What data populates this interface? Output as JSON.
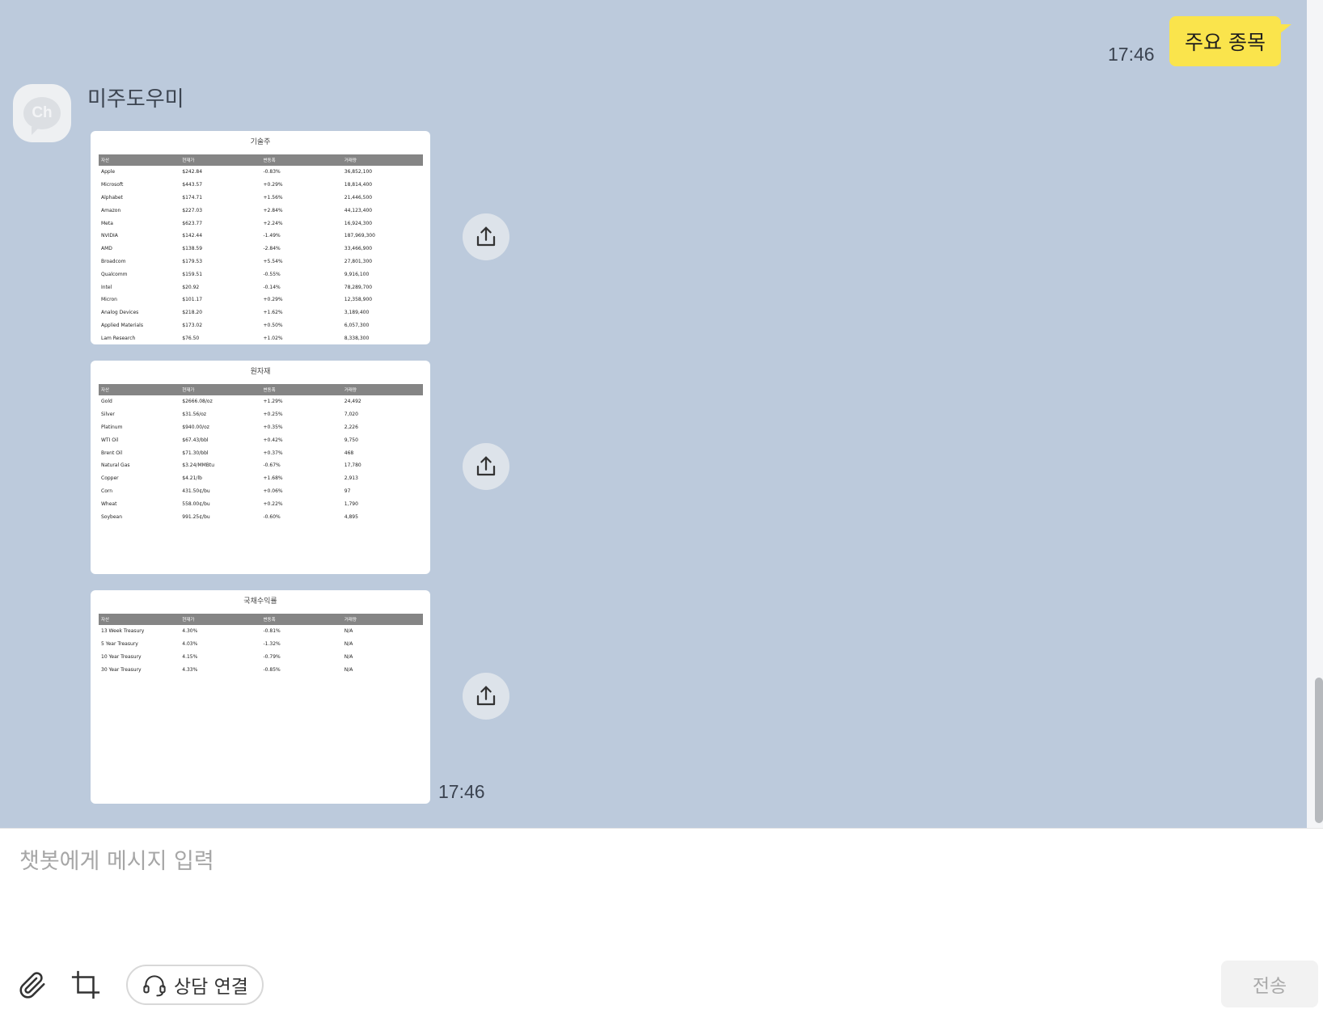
{
  "user_message": {
    "text": "주요 종목",
    "time": "17:46"
  },
  "bot": {
    "name": "미주도우미",
    "avatar_text": "Ch",
    "time": "17:46",
    "cards": [
      {
        "title": "기술주",
        "headers": [
          "자산",
          "현재가",
          "변동폭",
          "거래량"
        ],
        "rows": [
          [
            "Apple",
            "$242.84",
            "-0.83%",
            "36,852,100"
          ],
          [
            "Microsoft",
            "$443.57",
            "+0.29%",
            "18,814,400"
          ],
          [
            "Alphabet",
            "$174.71",
            "+1.56%",
            "21,446,500"
          ],
          [
            "Amazon",
            "$227.03",
            "+2.84%",
            "44,123,400"
          ],
          [
            "Meta",
            "$623.77",
            "+2.24%",
            "16,924,300"
          ],
          [
            "NVIDIA",
            "$142.44",
            "-1.49%",
            "187,969,300"
          ],
          [
            "AMD",
            "$138.59",
            "-2.84%",
            "33,466,900"
          ],
          [
            "Broadcom",
            "$179.53",
            "+5.54%",
            "27,801,300"
          ],
          [
            "Qualcomm",
            "$159.51",
            "-0.55%",
            "9,916,100"
          ],
          [
            "Intel",
            "$20.92",
            "-0.14%",
            "78,289,700"
          ],
          [
            "Micron",
            "$101.17",
            "+0.29%",
            "12,358,900"
          ],
          [
            "Analog Devices",
            "$218.20",
            "+1.62%",
            "3,189,400"
          ],
          [
            "Applied Materials",
            "$173.02",
            "+0.50%",
            "6,057,300"
          ],
          [
            "Lam Research",
            "$76.50",
            "+1.02%",
            "8,338,300"
          ]
        ]
      },
      {
        "title": "원자재",
        "headers": [
          "자산",
          "현재가",
          "변동폭",
          "거래량"
        ],
        "rows": [
          [
            "Gold",
            "$2666.08/oz",
            "+1.29%",
            "24,492"
          ],
          [
            "Silver",
            "$31.56/oz",
            "+0.25%",
            "7,020"
          ],
          [
            "Platinum",
            "$940.00/oz",
            "+0.35%",
            "2,226"
          ],
          [
            "WTI Oil",
            "$67.43/bbl",
            "+0.42%",
            "9,750"
          ],
          [
            "Brent Oil",
            "$71.30/bbl",
            "+0.37%",
            "468"
          ],
          [
            "Natural Gas",
            "$3.24/MMBtu",
            "-0.67%",
            "17,780"
          ],
          [
            "Copper",
            "$4.21/lb",
            "+1.68%",
            "2,913"
          ],
          [
            "Corn",
            "431.50¢/bu",
            "+0.06%",
            "97"
          ],
          [
            "Wheat",
            "558.00¢/bu",
            "+0.22%",
            "1,790"
          ],
          [
            "Soybean",
            "991.25¢/bu",
            "-0.60%",
            "4,895"
          ]
        ]
      },
      {
        "title": "국채수익률",
        "headers": [
          "자산",
          "현재가",
          "변동폭",
          "거래량"
        ],
        "rows": [
          [
            "13 Week Treasury",
            "4.30%",
            "-0.81%",
            "N/A"
          ],
          [
            "5 Year Treasury",
            "4.03%",
            "-1.32%",
            "N/A"
          ],
          [
            "10 Year Treasury",
            "4.15%",
            "-0.79%",
            "N/A"
          ],
          [
            "30 Year Treasury",
            "4.33%",
            "-0.85%",
            "N/A"
          ]
        ]
      }
    ]
  },
  "composer": {
    "placeholder": "챗봇에게 메시지 입력",
    "consult_label": "상담 연결",
    "send_label": "전송"
  },
  "icons": [
    "share-icon",
    "paperclip-icon",
    "crop-icon",
    "headset-icon"
  ],
  "colors": {
    "chat_background": "#bccadc",
    "my_bubble": "#fae44c"
  }
}
